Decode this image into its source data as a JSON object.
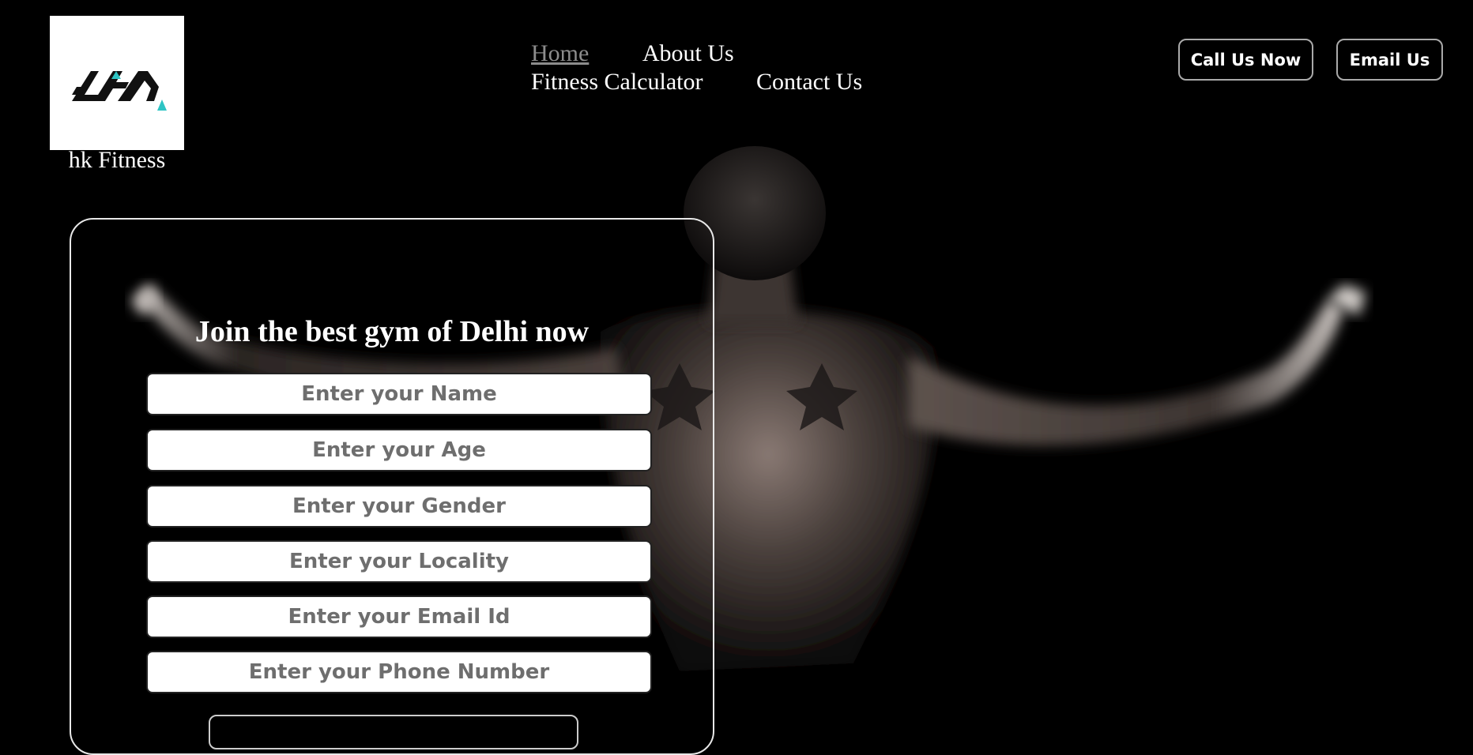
{
  "brand": {
    "name": "hk Fitness",
    "logo_icon": "gym-logo-icon",
    "accent_color": "#2ec4c4"
  },
  "nav": {
    "items": [
      {
        "label": "Home",
        "active": true
      },
      {
        "label": "About Us",
        "active": false
      },
      {
        "label": "Fitness Calculator",
        "active": false
      },
      {
        "label": "Contact Us",
        "active": false
      }
    ]
  },
  "header_buttons": {
    "call_label": "Call Us Now",
    "email_label": "Email Us"
  },
  "signup_form": {
    "title": "Join the best gym of Delhi now",
    "fields": [
      {
        "placeholder": "Enter your Name"
      },
      {
        "placeholder": "Enter your Age"
      },
      {
        "placeholder": "Enter your Gender"
      },
      {
        "placeholder": "Enter your Locality"
      },
      {
        "placeholder": "Enter your Email Id"
      },
      {
        "placeholder": "Enter your Phone Number"
      }
    ]
  },
  "colors": {
    "background": "#000000",
    "text": "#ffffff",
    "active_nav": "#8c8c8c"
  }
}
